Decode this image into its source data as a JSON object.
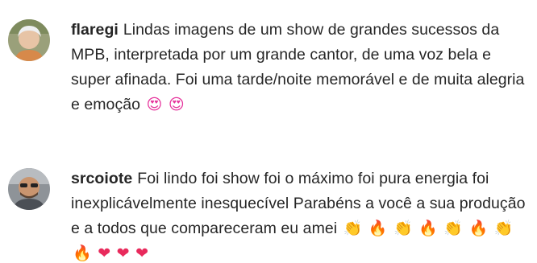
{
  "comments": [
    {
      "username": "flaregi",
      "text": "Lindas imagens de um show de grandes sucessos da MPB, interpretada por um grande cantor, de uma voz bela e super afinada. Foi uma tarde/noite memorável e de muita alegria e emoção",
      "emojis": [
        "😍",
        "😍"
      ]
    },
    {
      "username": "srcoiote",
      "text": "Foi lindo foi show foi o máximo foi pura energia foi inexplicávelmente inesquecível Parabéns a você a sua produção e a todos que compareceram eu amei",
      "emojis": [
        "👏",
        "🔥",
        "👏",
        "🔥",
        "👏",
        "🔥",
        "👏",
        "🔥",
        "❤",
        "❤",
        "❤"
      ]
    }
  ],
  "icons": {
    "heart_eyes": "smiling-face-with-heart-eyes-icon",
    "clap": "clapping-hands-icon",
    "fire": "fire-icon",
    "heart": "red-heart-icon"
  }
}
